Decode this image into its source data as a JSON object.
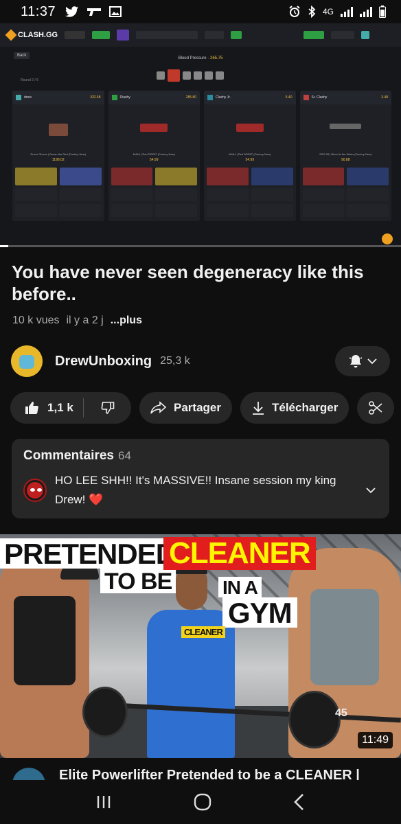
{
  "status_bar": {
    "time": "11:37",
    "network": "4G"
  },
  "player": {
    "site": {
      "logo": "CLASH.GG",
      "game_label": "Blood Pressure",
      "game_value": "265.75",
      "back": "Back",
      "round": "Round 2 / 5",
      "players": [
        {
          "name": "drew",
          "total": "332.58",
          "item": "Driver Gloves | Rezan the Red (Factory New)",
          "price": "1198.02"
        },
        {
          "name": "Diashy",
          "total": "285.80",
          "item": "M4A4 | Red DDPAT (Factory New)",
          "price": "54.99"
        },
        {
          "name": "Clashy Jr.",
          "total": "5.40",
          "item": "M4A4 | Red DDPAT (Factory New)",
          "price": "54.99"
        },
        {
          "name": "Sr. Clashy",
          "total": "3.48",
          "item": "SSG 08 | Blood in the Water (Factory New)",
          "price": "90.88"
        }
      ]
    },
    "progress": 0.02
  },
  "video": {
    "title": "You have never seen degeneracy like this before..",
    "views": "10 k vues",
    "age": "il y a 2 j",
    "more": "...plus"
  },
  "channel": {
    "name": "DrewUnboxing",
    "subscribers": "25,3 k"
  },
  "actions": {
    "likes": "1,1 k",
    "share": "Partager",
    "download": "Télécharger"
  },
  "comments": {
    "heading": "Commentaires",
    "count": "64",
    "top_comment": "HO LEE SHH!! It's MASSIVE!! Insane session my king Drew! ❤️"
  },
  "next_video": {
    "thumb_text": {
      "line1": "PRETENDED",
      "line2": "TO BE",
      "line3": "CLEANER",
      "line4": "IN A",
      "line5": "GYM",
      "badge": "CLEANER",
      "plate": "45"
    },
    "duration": "11:49",
    "title": "Elite Powerlifter Pretended to be a CLEANER |"
  },
  "colors": {
    "background": "#0f0f0f",
    "chip": "#272727",
    "secondary_text": "#aaaaaa"
  }
}
